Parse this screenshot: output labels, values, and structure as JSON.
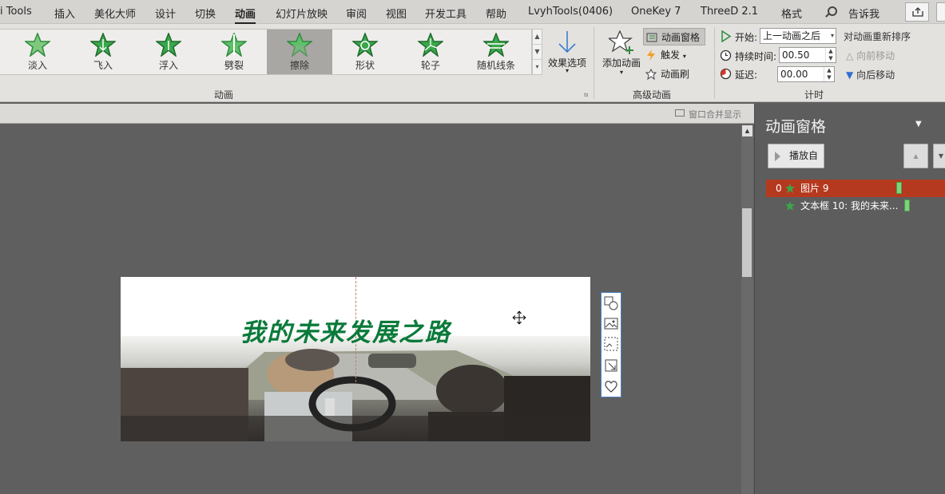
{
  "menu": {
    "items": [
      "i Tools",
      "插入",
      "美化大师",
      "设计",
      "切换",
      "动画",
      "幻灯片放映",
      "审阅",
      "视图",
      "开发工具",
      "帮助",
      "LvyhTools(0406)",
      "OneKey 7",
      "ThreeD 2.1",
      "格式"
    ],
    "active": "动画",
    "tell_me": "告诉我"
  },
  "gallery": {
    "items": [
      "淡入",
      "飞入",
      "浮入",
      "劈裂",
      "擦除",
      "形状",
      "轮子",
      "随机线条"
    ],
    "selected": "擦除"
  },
  "effect_options": {
    "label": "效果选项"
  },
  "group_labels": {
    "animation": "动画",
    "advanced": "高级动画",
    "timing": "计时"
  },
  "advanced": {
    "add_animation": "添加动画",
    "pane_button": "动画窗格",
    "trigger": "触发",
    "painter": "动画刷"
  },
  "timing": {
    "start_label": "开始:",
    "start_value": "上一动画之后",
    "duration_label": "持续时间:",
    "duration_value": "00.50",
    "delay_label": "延迟:",
    "delay_value": "00.00",
    "reorder_title": "对动画重新排序",
    "move_earlier": "向前移动",
    "move_later": "向后移动"
  },
  "merge_bar": {
    "label": "窗口合并显示"
  },
  "slide": {
    "title": "我的未来发展之路"
  },
  "pane": {
    "title": "动画窗格",
    "play_button": "播放自",
    "items": [
      {
        "index": "0",
        "name": "图片 9",
        "selected": true
      },
      {
        "index": "",
        "name": "文本框 10: 我的未来...",
        "selected": false
      }
    ]
  },
  "colors": {
    "selected_item": "#b5391f",
    "title_green": "#0a7a3a",
    "timeline_bar": "#7ed47a"
  }
}
